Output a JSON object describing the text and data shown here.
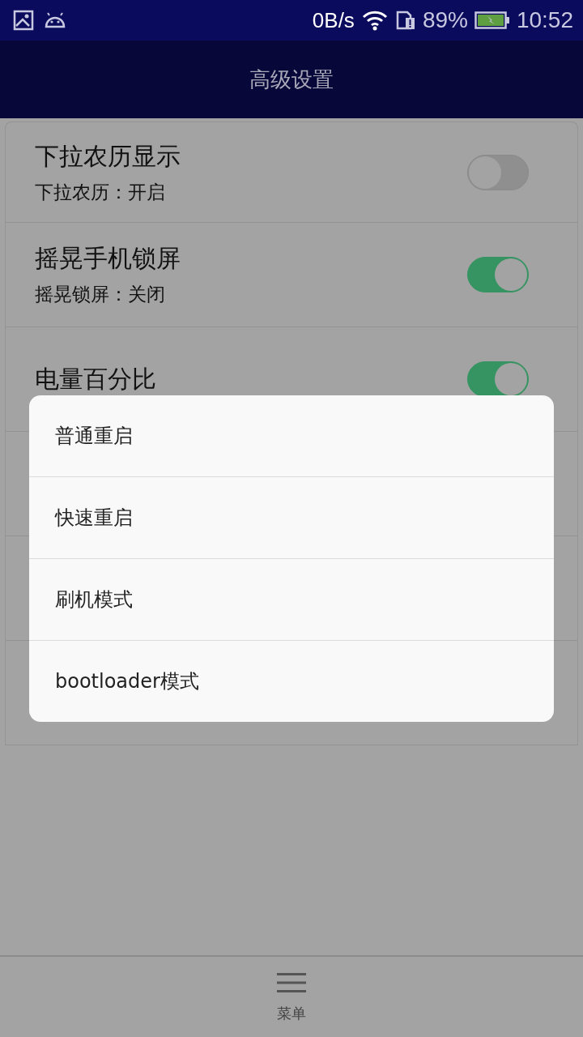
{
  "status_bar": {
    "net_speed": "0B/s",
    "battery_percent": "89%",
    "time": "10:52"
  },
  "title_bar": {
    "title": "高级设置"
  },
  "settings": [
    {
      "title": "下拉农历显示",
      "subtitle": "下拉农历：开启",
      "on": false
    },
    {
      "title": "摇晃手机锁屏",
      "subtitle": "摇晃锁屏：关闭",
      "on": true
    },
    {
      "title": "电量百分比",
      "on": true
    }
  ],
  "dialog": {
    "items": [
      {
        "label": "普通重启"
      },
      {
        "label": "快速重启"
      },
      {
        "label": "刷机模式"
      },
      {
        "label": "bootloader模式"
      }
    ]
  },
  "bottom_bar": {
    "menu_label": "菜单"
  }
}
